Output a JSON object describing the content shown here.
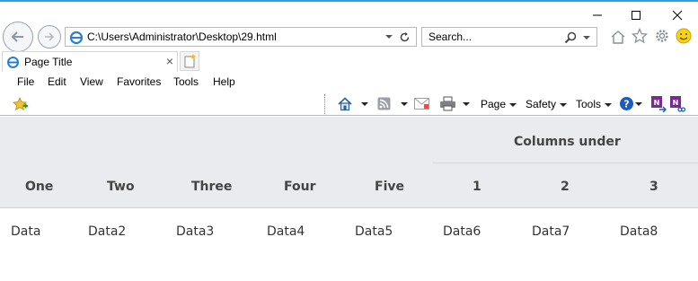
{
  "browser": {
    "address": "C:\\Users\\Administrator\\Desktop\\29.html",
    "search_placeholder": "Search...",
    "tab_title": "Page Title",
    "tab_close": "×",
    "menu": [
      "File",
      "Edit",
      "View",
      "Favorites",
      "Tools",
      "Help"
    ],
    "command_bar": {
      "page": "Page",
      "safety": "Safety",
      "tools": "Tools"
    },
    "accent_color": "#2f9fe2"
  },
  "table": {
    "group_header": "Columns under",
    "headers": [
      "One",
      "Two",
      "Three",
      "Four",
      "Five",
      "1",
      "2",
      "3"
    ],
    "row": [
      "Data",
      "Data2",
      "Data3",
      "Data4",
      "Data5",
      "Data6",
      "Data7",
      "Data8"
    ]
  }
}
